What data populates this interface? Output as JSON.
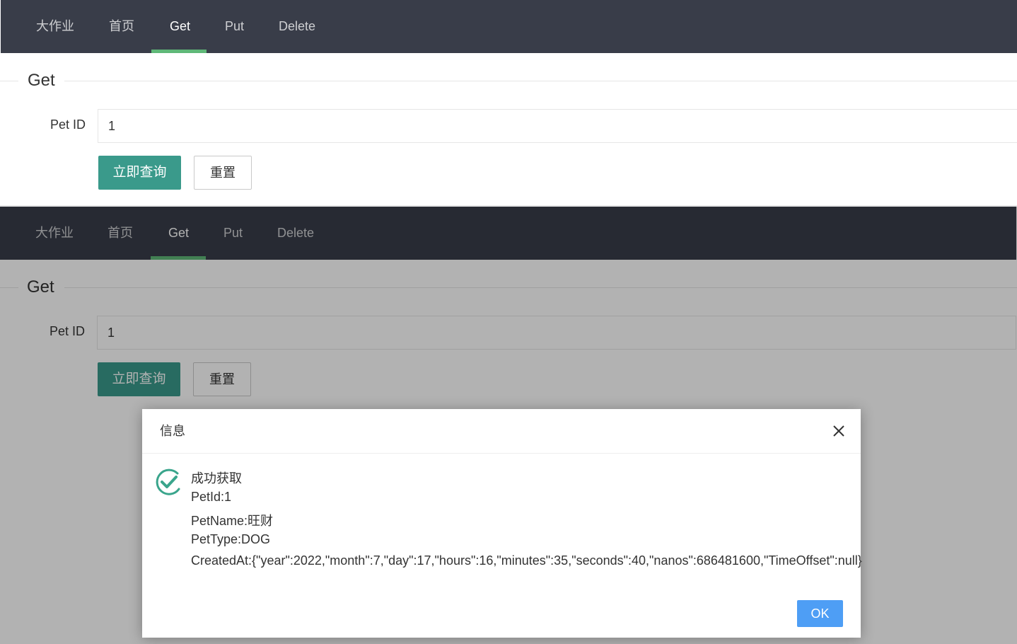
{
  "nav": {
    "brand": "大作业",
    "items": [
      {
        "label": "首页"
      },
      {
        "label": "Get"
      },
      {
        "label": "Put"
      },
      {
        "label": "Delete"
      }
    ],
    "active": "Get"
  },
  "form": {
    "title": "Get",
    "pet_id_label": "Pet ID",
    "pet_id_value": "1",
    "submit_label": "立即查询",
    "reset_label": "重置"
  },
  "dialog": {
    "title": "信息",
    "messages": [
      "成功获取",
      "PetId:1",
      "PetName:旺财",
      "PetType:DOG",
      "CreatedAt:{\"year\":2022,\"month\":7,\"day\":17,\"hours\":16,\"minutes\":35,\"seconds\":40,\"nanos\":686481600,\"TimeOffset\":null}"
    ],
    "ok_label": "OK"
  },
  "colors": {
    "navbar": "#393d49",
    "active_underline": "#5fb878",
    "primary_button": "#3a9a8b",
    "ok_button": "#4e9ef5",
    "success_icon": "#3aa58c"
  }
}
